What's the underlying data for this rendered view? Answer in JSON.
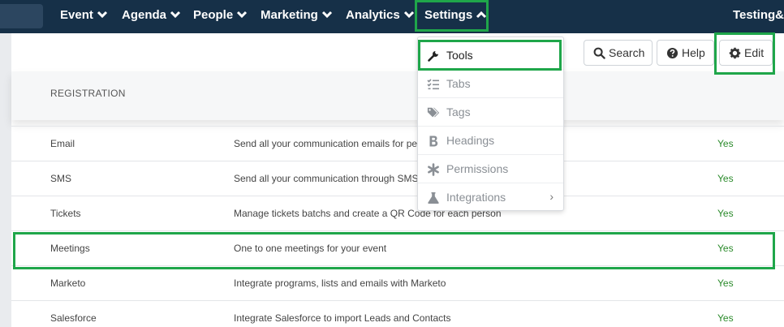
{
  "nav": {
    "items": [
      {
        "label": "Event"
      },
      {
        "label": "Agenda"
      },
      {
        "label": "People"
      },
      {
        "label": "Marketing"
      },
      {
        "label": "Analytics"
      },
      {
        "label": "Settings"
      }
    ],
    "user": "Testing&"
  },
  "toolbar": {
    "search_label": "Search",
    "help_label": "Help",
    "edit_label": "Edit"
  },
  "section": {
    "title": "REGISTRATION"
  },
  "rows": [
    {
      "name": "Email",
      "desc": "Send all your communication emails for peo",
      "value": "Yes"
    },
    {
      "name": "SMS",
      "desc": "Send all your communication through SMS",
      "value": "Yes"
    },
    {
      "name": "Tickets",
      "desc": "Manage tickets batchs and create a QR Code for each person",
      "value": "Yes"
    },
    {
      "name": "Meetings",
      "desc": "One to one meetings for your event",
      "value": "Yes"
    },
    {
      "name": "Marketo",
      "desc": "Integrate programs, lists and emails with Marketo",
      "value": "Yes"
    },
    {
      "name": "Salesforce",
      "desc": "Integrate Salesforce to import Leads and Contacts",
      "value": "Yes"
    }
  ],
  "dropdown": {
    "items": [
      {
        "label": "Tools",
        "icon": "wrench-icon"
      },
      {
        "label": "Tabs",
        "icon": "list-check-icon"
      },
      {
        "label": "Tags",
        "icon": "tags-icon"
      },
      {
        "label": "Headings",
        "icon": "bold-icon"
      },
      {
        "label": "Permissions",
        "icon": "asterisk-icon"
      },
      {
        "label": "Integrations",
        "icon": "flask-icon",
        "arrow": "›"
      }
    ]
  },
  "colors": {
    "nav_bg": "#163048",
    "highlight": "#1fa64a",
    "yes_text": "#2a8a2a"
  }
}
